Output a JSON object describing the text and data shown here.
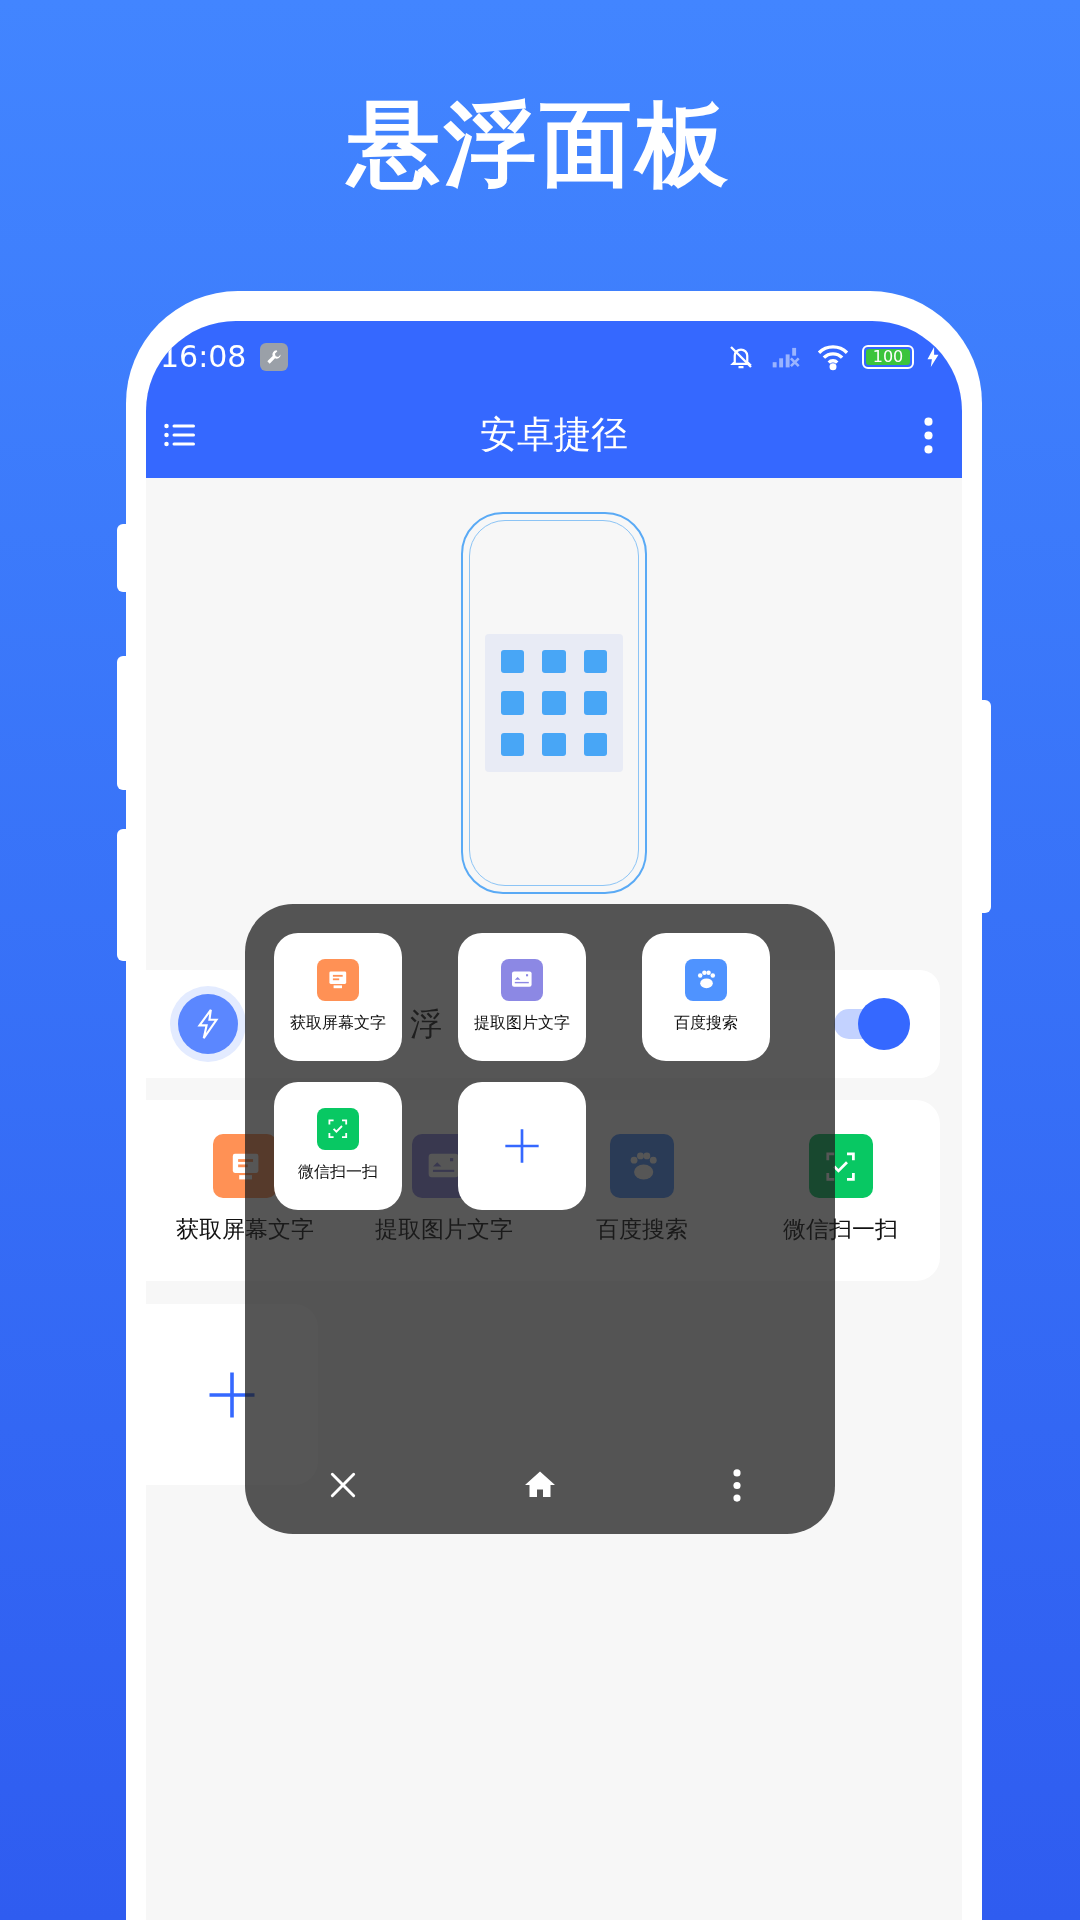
{
  "headline": "悬浮面板",
  "status_bar": {
    "time": "16:08",
    "battery": "100"
  },
  "app_bar": {
    "title": "安卓捷径"
  },
  "floating_ball": {
    "label": "浮",
    "on": true
  },
  "shortcuts": [
    {
      "label": "获取屏幕文字",
      "kind": "screen-text"
    },
    {
      "label": "提取图片文字",
      "kind": "image-text"
    },
    {
      "label": "百度搜索",
      "kind": "paw"
    },
    {
      "label": "微信扫一扫",
      "kind": "scan"
    }
  ],
  "panel": {
    "tiles": [
      {
        "label": "获取屏幕文字",
        "kind": "screen-text"
      },
      {
        "label": "提取图片文字",
        "kind": "image-text"
      },
      {
        "label": "百度搜索",
        "kind": "paw"
      },
      {
        "label": "微信扫一扫",
        "kind": "scan"
      },
      {
        "kind": "add"
      }
    ]
  }
}
